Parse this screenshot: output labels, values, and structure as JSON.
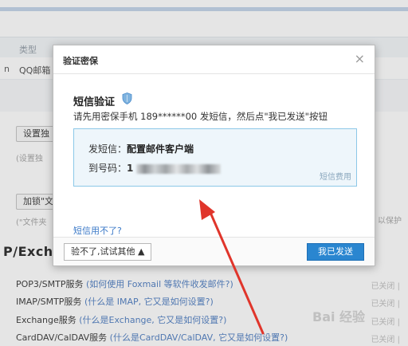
{
  "background": {
    "list_header": "类型",
    "list_row_prefix": "n",
    "list_row_text": "QQ邮箱",
    "button1": "设置独",
    "note1": "(设置独",
    "button2": "加锁\"文",
    "note2": "(\"文件夹",
    "right_note": "以保护",
    "section_title": "P/Excha",
    "services": [
      {
        "name": "POP3/SMTP服务",
        "link": "(如何使用 Foxmail 等软件收发邮件?)",
        "status": "已关闭 |"
      },
      {
        "name": "IMAP/SMTP服务",
        "link": "(什么是 IMAP, 它又是如何设置?)",
        "status": "已关闭 |"
      },
      {
        "name": "Exchange服务",
        "link": "(什么是Exchange, 它又是如何设置?)",
        "status": "已关闭 |"
      },
      {
        "name": "CardDAV/CalDAV服务",
        "link": "(什么是CardDAV/CalDAV, 它又是如何设置?)",
        "status": "已关闭 |"
      }
    ],
    "watermark": "Bai 经验"
  },
  "dialog": {
    "title": "验证密保",
    "close": "×",
    "sms_title": "短信验证",
    "sms_desc": "请先用密保手机 189******00 发短信，然后点\"我已发送\"按钮",
    "send_label": "发短信：",
    "send_content": "配置邮件客户端",
    "to_label": "到号码：",
    "to_first": "1",
    "fee": "短信费用",
    "sms_help": "短信用不了?",
    "try_other": "验不了,试试其他 ▲",
    "sent": "我已发送"
  },
  "colors": {
    "accent": "#2a86d0",
    "link": "#3c7ac8",
    "box_border": "#8cc8e8",
    "box_bg": "#eef6fb",
    "arrow": "#e0352b"
  }
}
